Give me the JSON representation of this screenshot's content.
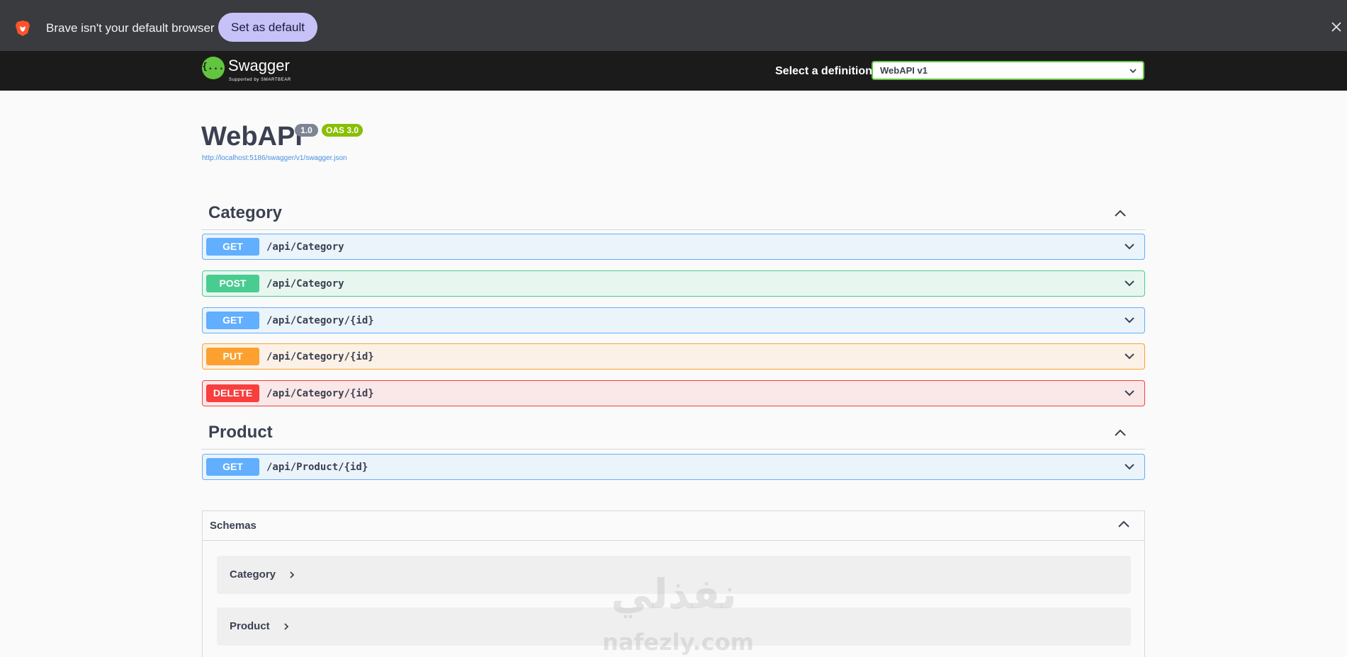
{
  "banner": {
    "message": "Brave isn't your default browser",
    "set_default_label": "Set as default"
  },
  "topbar": {
    "logo_icon_text": "{...}",
    "logo_title": "Swagger",
    "logo_subtitle": "Supported by SMARTBEAR",
    "definition_label": "Select a definition",
    "definition_value": "WebAPI v1"
  },
  "info": {
    "title": "WebAPI",
    "version": "1.0",
    "oas": "OAS 3.0",
    "url": "http://localhost:5186/swagger/v1/swagger.json"
  },
  "sections": [
    {
      "name": "Category",
      "operations": [
        {
          "method": "GET",
          "path": "/api/Category"
        },
        {
          "method": "POST",
          "path": "/api/Category"
        },
        {
          "method": "GET",
          "path": "/api/Category/{id}"
        },
        {
          "method": "PUT",
          "path": "/api/Category/{id}"
        },
        {
          "method": "DELETE",
          "path": "/api/Category/{id}"
        }
      ]
    },
    {
      "name": "Product",
      "operations": [
        {
          "method": "GET",
          "path": "/api/Product/{id}"
        }
      ]
    }
  ],
  "schemas": {
    "title": "Schemas",
    "models": [
      {
        "name": "Category"
      },
      {
        "name": "Product"
      }
    ]
  },
  "watermark": {
    "arabic": "نفذلي",
    "latin": "nafezly.com"
  },
  "colors": {
    "get": "#61affe",
    "post": "#49cc90",
    "put": "#fca130",
    "delete": "#f93e3e",
    "swagger_green": "#62c53f",
    "oas_badge": "#89bf04",
    "version_badge": "#7d8492",
    "banner_button": "#c6c2f8"
  },
  "icons": {
    "browser": "brave-lion-icon",
    "close": "close-icon",
    "select_caret": "chevron-down-icon",
    "section_toggle": "chevron-up-icon",
    "operation_expand": "chevron-down-icon",
    "model_expand": "chevron-right-icon"
  }
}
